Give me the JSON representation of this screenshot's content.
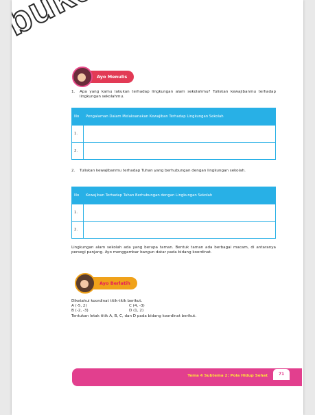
{
  "watermark": "buku",
  "section1": {
    "badge": "Ayo Menulis"
  },
  "q1": {
    "num": "1.",
    "text": "Apa yang kamu lakukan terhadap lingkungan alam sekolahmu? Tuliskan kewajibanmu terhadap lingkungan sekolahmu."
  },
  "table1": {
    "head_no": "No",
    "head_col": "Pengalaman Dalam Melaksanakan Kewajiban Terhadap Lingkungan Sekolah",
    "rows": [
      "1.",
      "2."
    ]
  },
  "q2": {
    "num": "2.",
    "text": "Tuliskan kewajibanmu terhadap Tuhan yang berhubungan dengan lingkungan sekolah."
  },
  "table2": {
    "head_no": "No",
    "head_col": "Kewajiban Terhadap Tuhan Berhubungan dengan Lingkungan Sekolah",
    "rows": [
      "1.",
      "2."
    ]
  },
  "paragraph": "Lingkungan alam sekolah ada yang berupa taman. Bentuk taman ada berbagai macam, di antaranya persegi panjang. Ayo menggambar bangun datar pada bidang koordinat.",
  "section2": {
    "badge": "Ayo Berlatih"
  },
  "coords": {
    "intro": "Diketahui koordinat titik-titik berikut.",
    "a": "A (-5, 2)",
    "c": "C (4, -3)",
    "b": "B (-2, -3)",
    "d": "D (1, 2)",
    "instruction": "Tentukan letak titik A, B, C, dan D pada bidang koordinat berikut."
  },
  "footer": {
    "text": "Tema 4 Subtema 2: Pola Hidup Sehat",
    "page": "71"
  },
  "colors": {
    "table_blue": "#28b0e6",
    "footer_pink": "#e23f8e",
    "badge_red": "#e23a55",
    "badge_orange": "#f0a21a"
  }
}
